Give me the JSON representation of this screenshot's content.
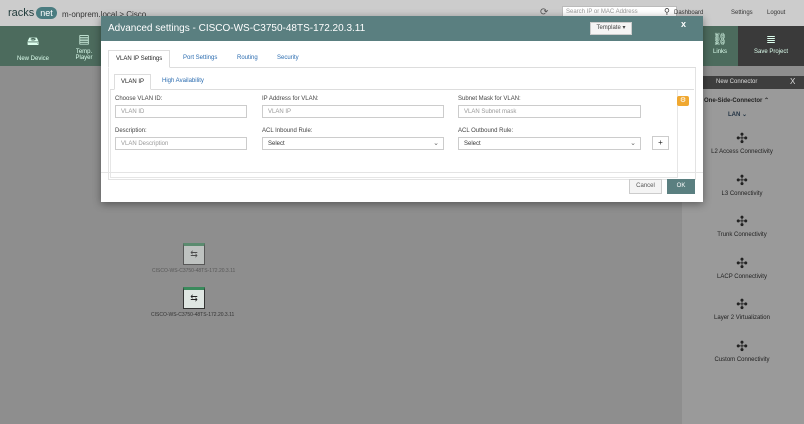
{
  "topbar": {
    "logo_main": "racks",
    "logo_badge": "net",
    "breadcrumb": "m-onprem.local > Cisco",
    "search_placeholder": "Search IP or MAC Address",
    "nav": [
      "Dashboard",
      "Settings",
      "Logout"
    ]
  },
  "toolbar": {
    "items": [
      {
        "label": "New Device",
        "icon": "device-icon"
      },
      {
        "label": "Temp. Player",
        "icon": "template-icon"
      },
      {
        "label": "Links",
        "icon": "links-icon"
      },
      {
        "label": "Save Project",
        "icon": "server-icon"
      }
    ]
  },
  "canvas": {
    "devices": [
      {
        "label": "CISCO-WS-C3750-48TS-172.20.3.11",
        "icon": "switch-icon"
      },
      {
        "label": "CISCO-WS-C3750-48TS-172.20.3.11",
        "icon": "switch-icon"
      }
    ]
  },
  "connector_panel": {
    "title": "New Connector",
    "close": "X",
    "subtitle": "One-Side-Connector",
    "lan": "LAN",
    "items": [
      "L2 Access Connectivity",
      "L3 Connectivity",
      "Trunk Connectivity",
      "LACP Connectivity",
      "Layer 2 Virtualization",
      "Custom Connectivity"
    ]
  },
  "modal": {
    "title": "Advanced settings - CISCO-WS-C3750-48TS-172.20.3.11",
    "template_label": "Template",
    "close": "x",
    "tabs": [
      "VLAN IP Settings",
      "Port Settings",
      "Routing",
      "Security"
    ],
    "subtabs": [
      "VLAN IP",
      "High Availability"
    ],
    "form": {
      "vlan_id_label": "Choose VLAN ID:",
      "vlan_id_placeholder": "VLAN ID",
      "ip_label": "IP Address for VLAN:",
      "ip_placeholder": "VLAN IP",
      "mask_label": "Subnet Mask for VLAN:",
      "mask_placeholder": "VLAN Subnet mask",
      "desc_label": "Description:",
      "desc_placeholder": "VLAN Description",
      "acl_in_label": "ACL Inbound Rule:",
      "acl_in_value": "Select",
      "acl_out_label": "ACL Outbound Rule:",
      "acl_out_value": "Select",
      "plus": "+"
    },
    "cancel": "Cancel",
    "ok": "OK"
  },
  "colors": {
    "header": "#5a7f80",
    "toolbar": "#4c6b5d",
    "accent_orange": "#f0a830"
  }
}
